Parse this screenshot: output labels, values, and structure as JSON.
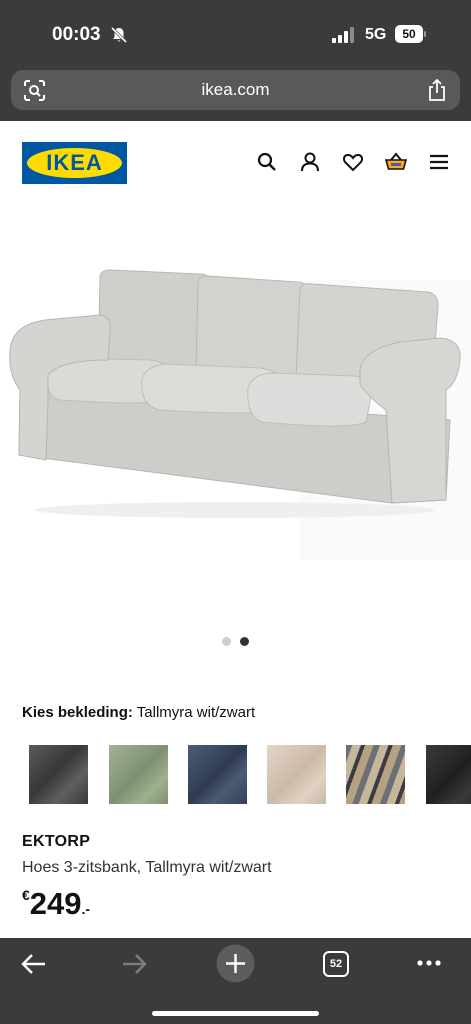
{
  "status_bar": {
    "time": "00:03",
    "network": "5G",
    "battery": "50"
  },
  "url_bar": {
    "domain": "ikea.com"
  },
  "header": {
    "logo_text": "IKEA",
    "icons": [
      "search-icon",
      "account-icon",
      "heart-icon",
      "basket-icon",
      "menu-icon"
    ],
    "colors": {
      "ikea_blue": "#0058a3",
      "ikea_yellow": "#ffdb00"
    }
  },
  "gallery": {
    "image_count": 2,
    "active_index": 1
  },
  "fabric": {
    "label": "Kies bekleding:",
    "selected": "Tallmyra wit/zwart",
    "swatches": [
      {
        "name": "dark grey",
        "color": "#4a4a4c"
      },
      {
        "name": "green",
        "color": "#8fa27f"
      },
      {
        "name": "blue",
        "color": "#3e4d66"
      },
      {
        "name": "beige",
        "color": "#d8c8b8"
      },
      {
        "name": "striped",
        "color": "#a59a85"
      },
      {
        "name": "black",
        "color": "#2e2e30"
      }
    ]
  },
  "product": {
    "name": "EKTORP",
    "description": "Hoes 3-zitsbank, Tallmyra wit/zwart",
    "price_currency": "€",
    "price_amount": "249",
    "price_suffix": ".-"
  },
  "bottom_bar": {
    "tab_count": "52"
  }
}
